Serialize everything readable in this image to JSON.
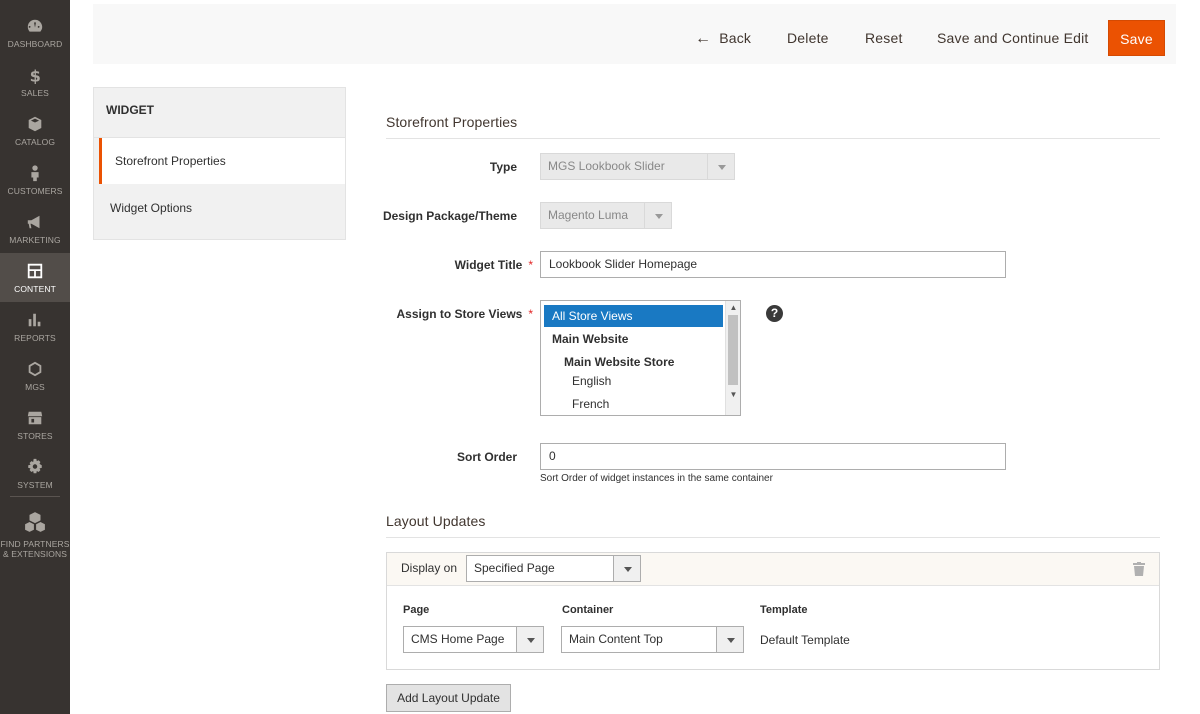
{
  "sidebar": {
    "items": [
      {
        "label": "DASHBOARD",
        "icon": "dashboard-icon"
      },
      {
        "label": "SALES",
        "icon": "dollar-icon"
      },
      {
        "label": "CATALOG",
        "icon": "box-icon"
      },
      {
        "label": "CUSTOMERS",
        "icon": "person-icon"
      },
      {
        "label": "MARKETING",
        "icon": "megaphone-icon"
      },
      {
        "label": "CONTENT",
        "icon": "layout-icon"
      },
      {
        "label": "REPORTS",
        "icon": "bar-chart-icon"
      },
      {
        "label": "MGS",
        "icon": "hexagon-icon"
      },
      {
        "label": "STORES",
        "icon": "storefront-icon"
      },
      {
        "label": "SYSTEM",
        "icon": "gear-icon"
      },
      {
        "label": "FIND PARTNERS",
        "label2": "& EXTENSIONS",
        "icon": "cubes-icon"
      }
    ]
  },
  "actions": {
    "back": "Back",
    "delete": "Delete",
    "reset": "Reset",
    "save_continue": "Save and Continue Edit",
    "save": "Save"
  },
  "tabs": {
    "header": "WIDGET",
    "items": [
      "Storefront Properties",
      "Widget Options"
    ]
  },
  "storefront": {
    "title": "Storefront Properties",
    "type_label": "Type",
    "type_value": "MGS Lookbook Slider",
    "theme_label": "Design Package/Theme",
    "theme_value": "Magento Luma",
    "widget_title_label": "Widget Title",
    "widget_title_value": "Lookbook Slider Homepage",
    "store_views_label": "Assign to Store Views",
    "store_views": [
      "All Store Views",
      "Main Website",
      "Main Website Store",
      "English",
      "French"
    ],
    "sort_order_label": "Sort Order",
    "sort_order_value": "0",
    "sort_order_note": "Sort Order of widget instances in the same container",
    "required_mark": "*",
    "help": "?"
  },
  "layout_updates": {
    "title": "Layout Updates",
    "display_on_label": "Display on",
    "display_on_value": "Specified Page",
    "page_label": "Page",
    "page_value": "CMS Home Page",
    "container_label": "Container",
    "container_value": "Main Content Top",
    "template_label": "Template",
    "template_value": "Default Template",
    "add_button": "Add Layout Update"
  },
  "colors": {
    "accent": "#eb5202",
    "sidebar": "#373330",
    "selection": "#1979c3"
  }
}
